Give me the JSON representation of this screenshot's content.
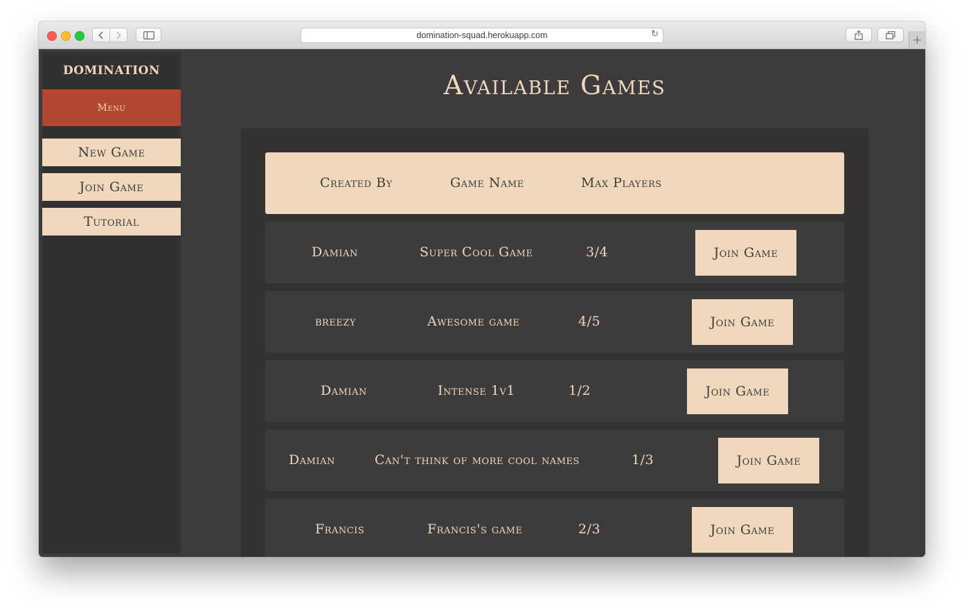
{
  "browser": {
    "url": "domination-squad.herokuapp.com"
  },
  "sidebar": {
    "brand": "DOMINATION",
    "menu_label": "Menu",
    "items": [
      {
        "label": "New Game"
      },
      {
        "label": "Join Game"
      },
      {
        "label": "Tutorial"
      }
    ]
  },
  "main": {
    "title": "Available Games",
    "columns": {
      "created_by": "Created By",
      "game_name": "Game Name",
      "max_players": "Max Players"
    },
    "games": [
      {
        "created_by": "Damian",
        "game_name": "Super Cool Game",
        "players": "3/4",
        "action": "Join Game"
      },
      {
        "created_by": "breezy",
        "game_name": "Awesome game",
        "players": "4/5",
        "action": "Join Game"
      },
      {
        "created_by": "Damian",
        "game_name": "Intense 1v1",
        "players": "1/2",
        "action": "Join Game"
      },
      {
        "created_by": "Damian",
        "game_name": "Can't think of more cool names",
        "players": "1/3",
        "action": "Join Game"
      },
      {
        "created_by": "Francis",
        "game_name": "Francis's game",
        "players": "2/3",
        "action": "Join Game"
      }
    ]
  },
  "colors": {
    "background": "#3d3b3c",
    "sidebar": "#323031",
    "panel": "#333132",
    "accent_red": "#b34633",
    "cream": "#f0d8bd"
  }
}
